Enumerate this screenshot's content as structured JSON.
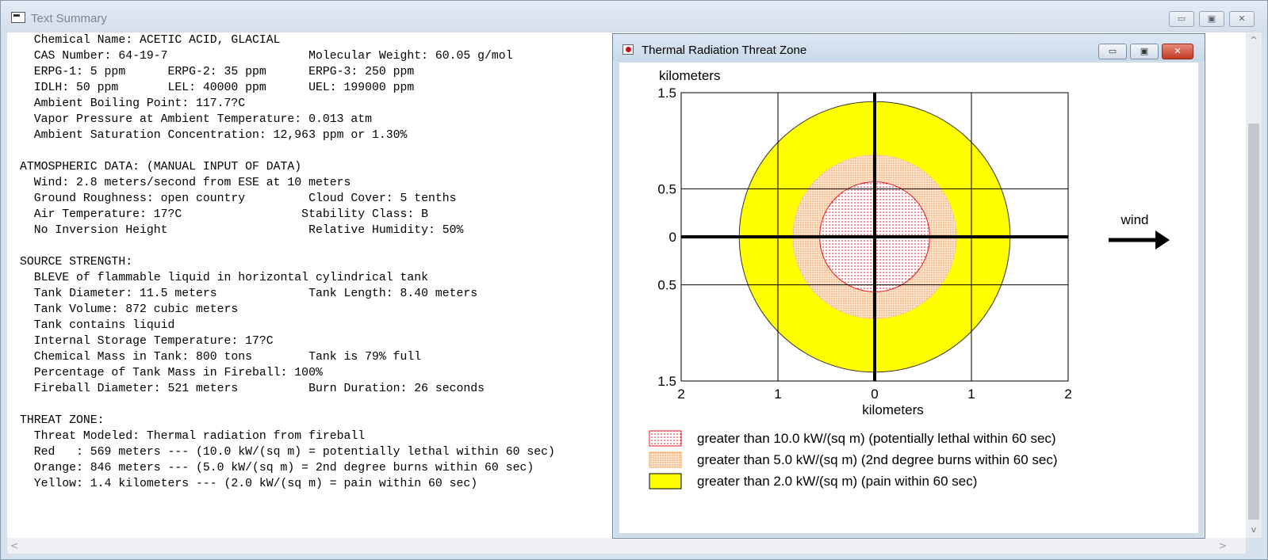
{
  "main_window": {
    "title": "Text Summary",
    "controls": {
      "minimize": "▭",
      "maximize": "▣",
      "close": "✕"
    },
    "summary_lines": [
      "  Chemical Name: ACETIC ACID, GLACIAL",
      "  CAS Number: 64-19-7                    Molecular Weight: 60.05 g/mol",
      "  ERPG-1: 5 ppm      ERPG-2: 35 ppm      ERPG-3: 250 ppm",
      "  IDLH: 50 ppm       LEL: 40000 ppm      UEL: 199000 ppm",
      "  Ambient Boiling Point: 117.7?C",
      "  Vapor Pressure at Ambient Temperature: 0.013 atm",
      "  Ambient Saturation Concentration: 12,963 ppm or 1.30%",
      "",
      "ATMOSPHERIC DATA: (MANUAL INPUT OF DATA)",
      "  Wind: 2.8 meters/second from ESE at 10 meters",
      "  Ground Roughness: open country         Cloud Cover: 5 tenths",
      "  Air Temperature: 17?C                 Stability Class: B",
      "  No Inversion Height                    Relative Humidity: 50%",
      "",
      "SOURCE STRENGTH:",
      "  BLEVE of flammable liquid in horizontal cylindrical tank",
      "  Tank Diameter: 11.5 meters             Tank Length: 8.40 meters",
      "  Tank Volume: 872 cubic meters",
      "  Tank contains liquid",
      "  Internal Storage Temperature: 17?C",
      "  Chemical Mass in Tank: 800 tons        Tank is 79% full",
      "  Percentage of Tank Mass in Fireball: 100%",
      "  Fireball Diameter: 521 meters          Burn Duration: 26 seconds",
      "",
      "THREAT ZONE:",
      "  Threat Modeled: Thermal radiation from fireball",
      "  Red   : 569 meters --- (10.0 kW/(sq m) = potentially lethal within 60 sec)",
      "  Orange: 846 meters --- (5.0 kW/(sq m) = 2nd degree burns within 60 sec)",
      "  Yellow: 1.4 kilometers --- (2.0 kW/(sq m) = pain within 60 sec)"
    ],
    "scroll": {
      "left_arrow": "<",
      "right_arrow": ">",
      "up_arrow": "^",
      "down_arrow": "v"
    }
  },
  "threat_window": {
    "title": "Thermal Radiation Threat Zone",
    "controls": {
      "minimize": "▭",
      "maximize": "▣",
      "close": "✕"
    },
    "y_axis_unit": "kilometers",
    "x_axis_unit": "kilometers",
    "y_ticks": [
      "1.5",
      "0.5",
      "0",
      "0.5",
      "1.5"
    ],
    "x_ticks": [
      "2",
      "1",
      "0",
      "1",
      "2"
    ],
    "wind_label": "wind",
    "legend": [
      {
        "label": "greater than 10.0 kW/(sq m) (potentially lethal within 60 sec)",
        "color": "#e8141c"
      },
      {
        "label": "greater than 5.0 kW/(sq m) (2nd degree burns within 60 sec)",
        "color": "#f6a85a"
      },
      {
        "label": "greater than 2.0 kW/(sq m) (pain within 60 sec)",
        "color": "#ffff00"
      }
    ]
  },
  "chart_data": {
    "type": "scatter",
    "xlim": [
      -2,
      2
    ],
    "ylim": [
      -1.5,
      1.5
    ],
    "xlabel": "kilometers",
    "ylabel": "kilometers",
    "grid": true,
    "zones": [
      {
        "radius_km": 0.569,
        "color": "#e8141c"
      },
      {
        "radius_km": 0.846,
        "color": "#f6a85a"
      },
      {
        "radius_km": 1.4,
        "color": "#ffff00"
      }
    ],
    "wind_direction": "right"
  }
}
